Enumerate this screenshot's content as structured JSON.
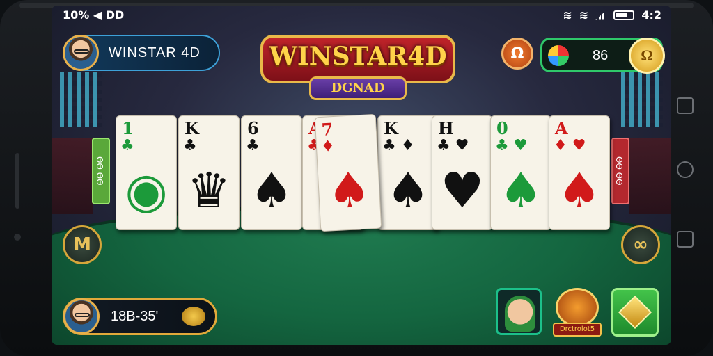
{
  "status_bar": {
    "left": "10% ◀ DD",
    "time": "4:2"
  },
  "player": {
    "name": "WINSTAR  4D"
  },
  "logo": {
    "title": "WINSTAR4D",
    "subtitle": "DGNAD"
  },
  "coins": {
    "value": "86",
    "coin_glyph": "Ω"
  },
  "top_button": {
    "glyph": "Ω"
  },
  "side_tabs": {
    "left": "ΘΘ ΘΘ",
    "right": "ΘΘ ΘΘ"
  },
  "cards": [
    {
      "rank": "1",
      "pip": "♣",
      "color": "green",
      "art": "◉"
    },
    {
      "rank": "K",
      "pip": "♣",
      "color": "black",
      "art": "♛"
    },
    {
      "rank": "6",
      "pip": "♣",
      "color": "black",
      "art": "♠"
    },
    {
      "rank": "A",
      "pip": "♣",
      "color": "red",
      "art": "♦"
    },
    {
      "rank": "7",
      "pip": "♦",
      "color": "red",
      "art": "♠"
    },
    {
      "rank": "K",
      "pip": "♣ ♦",
      "color": "black",
      "art": "♠"
    },
    {
      "rank": "H",
      "pip": "♣ ♥",
      "color": "black",
      "art": "♥"
    },
    {
      "rank": "0",
      "pip": "♣ ♥",
      "color": "green",
      "art": "♠"
    },
    {
      "rank": "A",
      "pip": "♦ ♥",
      "color": "red",
      "art": "♠"
    }
  ],
  "bottom_player": {
    "amount": "18B-35'"
  },
  "left_button": {
    "glyph": "M"
  },
  "right_button": {
    "glyph": "∞"
  },
  "shop": {
    "label": "Drctrolot5"
  }
}
